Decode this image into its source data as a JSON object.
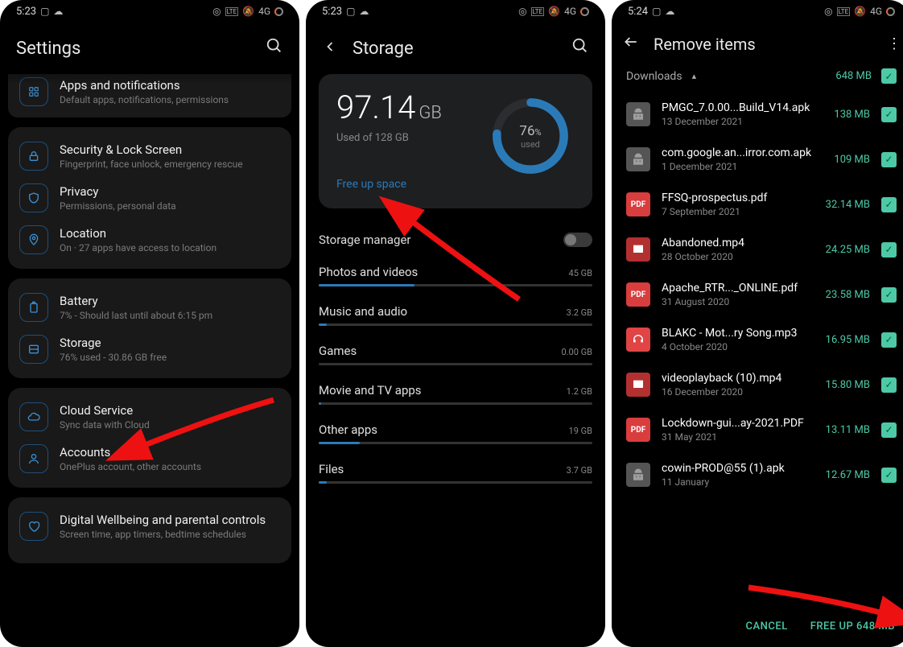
{
  "statusbar": {
    "time1": "5:23",
    "time3": "5:24",
    "signal": "4G"
  },
  "p1": {
    "title": "Settings",
    "cut": {
      "title": "Apps and notifications",
      "sub": "Default apps, notifications, permissions"
    },
    "card1": [
      {
        "icon": "lock",
        "title": "Security & Lock Screen",
        "sub": "Fingerprint, face unlock, emergency rescue"
      },
      {
        "icon": "shield",
        "title": "Privacy",
        "sub": "Permissions, personal data"
      },
      {
        "icon": "pin",
        "title": "Location",
        "sub": "On · 27 apps have access to location"
      }
    ],
    "card2": [
      {
        "icon": "battery",
        "title": "Battery",
        "sub": "7% - Should last until about 6:15 pm"
      },
      {
        "icon": "storage",
        "title": "Storage",
        "sub": "76% used - 30.86 GB free"
      }
    ],
    "card3": [
      {
        "icon": "cloud",
        "title": "Cloud Service",
        "sub": "Sync data with Cloud"
      },
      {
        "icon": "user",
        "title": "Accounts",
        "sub": "OnePlus account, other accounts"
      }
    ],
    "last": {
      "title": "Digital Wellbeing and parental controls",
      "sub": "Screen time, app timers, bedtime schedules"
    }
  },
  "p2": {
    "title": "Storage",
    "used_val": "97.14",
    "used_unit": "GB",
    "used_of": "Used of 128 GB",
    "free_up": "Free up space",
    "pct": "76",
    "pct_sym": "%",
    "pct_label": "used",
    "mgr": "Storage manager",
    "cats": [
      {
        "name": "Photos and videos",
        "size": "45 GB",
        "fill": 35
      },
      {
        "name": "Music and audio",
        "size": "3.2 GB",
        "fill": 3
      },
      {
        "name": "Games",
        "size": "0.00 GB",
        "fill": 0
      },
      {
        "name": "Movie and TV apps",
        "size": "1.2 GB",
        "fill": 1
      },
      {
        "name": "Other apps",
        "size": "19 GB",
        "fill": 15
      },
      {
        "name": "Files",
        "size": "3.7 GB",
        "fill": 3
      }
    ]
  },
  "p3": {
    "title": "Remove items",
    "section": "Downloads",
    "section_size": "648 MB",
    "files": [
      {
        "ic": "apk",
        "name": "PMGC_7.0.00...Build_V14.apk",
        "date": "13 December 2021",
        "size": "138 MB"
      },
      {
        "ic": "apk",
        "name": "com.google.an...irror.com.apk",
        "date": "1 December 2021",
        "size": "109 MB"
      },
      {
        "ic": "pdf",
        "name": "FFSQ-prospectus.pdf",
        "date": "7 September 2021",
        "size": "32.14 MB"
      },
      {
        "ic": "mp4",
        "name": "Abandoned.mp4",
        "date": "28 October 2020",
        "size": "24.25 MB"
      },
      {
        "ic": "pdf",
        "name": "Apache_RTR..._ONLINE.pdf",
        "date": "31 August 2020",
        "size": "23.58 MB"
      },
      {
        "ic": "mp3",
        "name": "BLAKC - Mot...ry Song.mp3",
        "date": "4 October 2020",
        "size": "16.95 MB"
      },
      {
        "ic": "mp4",
        "name": "videoplayback (10).mp4",
        "date": "16 December 2020",
        "size": "15.80 MB"
      },
      {
        "ic": "pdf",
        "name": "Lockdown-gui...ay-2021.PDF",
        "date": "31 May 2021",
        "size": "13.11 MB"
      },
      {
        "ic": "apk",
        "name": "cowin-PROD@55 (1).apk",
        "date": "11 January",
        "size": "12.67 MB"
      }
    ],
    "cancel": "CANCEL",
    "freeup": "FREE UP 648 MB"
  }
}
